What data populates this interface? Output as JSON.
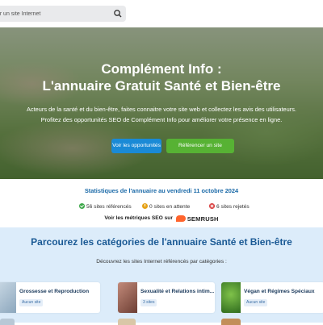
{
  "search": {
    "placeholder": "her un site Internet"
  },
  "hero": {
    "title_line1": "Complément Info :",
    "title_line2": "L'annuaire Gratuit Santé et Bien-être",
    "desc_line1": "Acteurs de la santé et du bien-être, faites connaitre votre site web et collectez les avis des utilisateurs.",
    "desc_line2": "Profitez des opportunités SEO de Complément Info pour améliorer votre présence en ligne.",
    "btn_opportunities": "Voir les opportunités",
    "btn_reference": "Référencer un site",
    "colors": {
      "blue_button": "#1a8ad6",
      "green_button": "#57b234"
    }
  },
  "stats": {
    "title": "Statistiques de l'annuaire au vendredi 11 octobre 2024",
    "referenced": "56 sites référencés",
    "pending": "0 sites en attente",
    "rejected": "6 sites rejetés",
    "seo_text": "Voir les métriques SEO sur",
    "semrush": "SEMRUSH"
  },
  "categories": {
    "title": "Parcourez les catégories de l'annuaire Santé et Bien-être",
    "subtitle": "Découvrez les sites Internet référencés par catégories :",
    "items": [
      {
        "name": "Grossesse et Reproduction",
        "badge": "Aucun site",
        "icon": "pregnancy-photo"
      },
      {
        "name": "Sexualité et Relations intim...",
        "badge": "3 sites",
        "icon": "couple-photo"
      },
      {
        "name": "Végan et Régimes Spéciaux",
        "badge": "Aucun site",
        "icon": "vegan-photo"
      }
    ]
  }
}
